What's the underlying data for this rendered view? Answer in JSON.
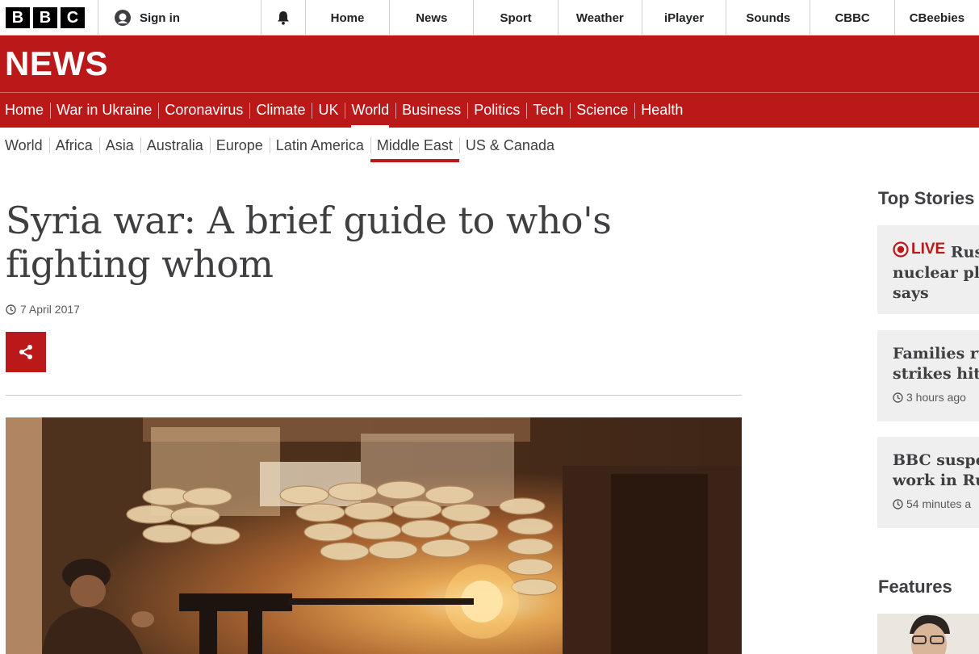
{
  "global_nav": {
    "logo_letters": [
      "B",
      "B",
      "C"
    ],
    "sign_in": "Sign in",
    "links": [
      "Home",
      "News",
      "Sport",
      "Weather",
      "iPlayer",
      "Sounds",
      "CBBC",
      "CBeebies"
    ]
  },
  "masthead": {
    "brand": "NEWS"
  },
  "primary_nav": {
    "items": [
      "Home",
      "War in Ukraine",
      "Coronavirus",
      "Climate",
      "UK",
      "World",
      "Business",
      "Politics",
      "Tech",
      "Science",
      "Health"
    ],
    "active": "World"
  },
  "secondary_nav": {
    "items": [
      "World",
      "Africa",
      "Asia",
      "Australia",
      "Europe",
      "Latin America",
      "Middle East",
      "US & Canada"
    ],
    "active": "Middle East"
  },
  "article": {
    "headline": "Syria war: A brief guide to who's fighting whom",
    "date": "7 April 2017"
  },
  "sidebar": {
    "top_stories_heading": "Top Stories",
    "stories": [
      {
        "live_label": "LIVE",
        "title_lines": [
          "Rus",
          "nuclear pla",
          "says"
        ],
        "time": ""
      },
      {
        "live_label": "",
        "title_lines": [
          "Families ru",
          "strikes hit"
        ],
        "time": "3 hours ago"
      },
      {
        "live_label": "",
        "title_lines": [
          "BBC suspe",
          "work in Ru"
        ],
        "time": "54 minutes a"
      }
    ],
    "features_heading": "Features"
  },
  "colors": {
    "brand_red": "#bb1919",
    "text_dark": "#3f3f42",
    "card_grey": "#efefef"
  },
  "icons": [
    "avatar-icon",
    "bell-icon",
    "clock-icon",
    "share-icon",
    "live-icon"
  ]
}
